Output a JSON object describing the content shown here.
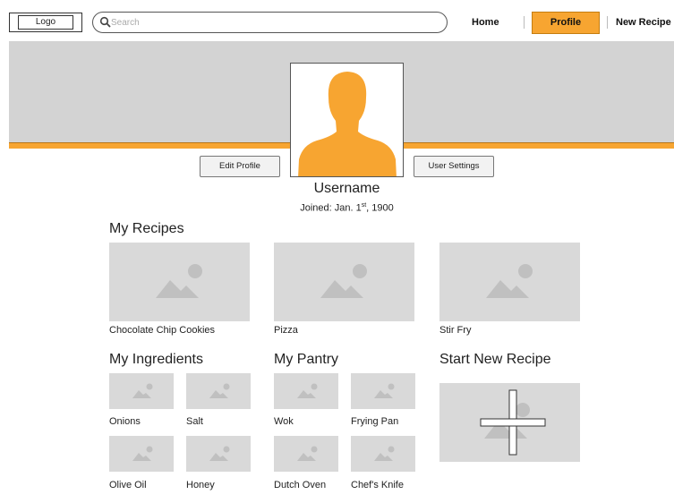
{
  "header": {
    "logo_label": "Logo",
    "search_placeholder": "Search",
    "nav": [
      {
        "label": "Home",
        "active": false
      },
      {
        "label": "Profile",
        "active": true
      },
      {
        "label": "New Recipe",
        "active": false
      }
    ]
  },
  "profile": {
    "edit_button": "Edit Profile",
    "settings_button": "User Settings",
    "username": "Username",
    "joined_prefix": "Joined: Jan. 1",
    "joined_suffix": "st",
    "joined_year": ", 1900"
  },
  "recipes": {
    "title": "My Recipes",
    "items": [
      "Chocolate Chip Cookies",
      "Pizza",
      "Stir Fry"
    ]
  },
  "ingredients": {
    "title": "My Ingredients",
    "items": [
      "Onions",
      "Salt",
      "Olive Oil",
      "Honey"
    ]
  },
  "pantry": {
    "title": "My Pantry",
    "items": [
      "Wok",
      "Frying Pan",
      "Dutch Oven",
      "Chef's Knife"
    ]
  },
  "new_recipe": {
    "title": "Start New Recipe"
  },
  "colors": {
    "accent": "#f7a531",
    "banner": "#d3d3d3",
    "placeholder": "#d9d9d9"
  }
}
